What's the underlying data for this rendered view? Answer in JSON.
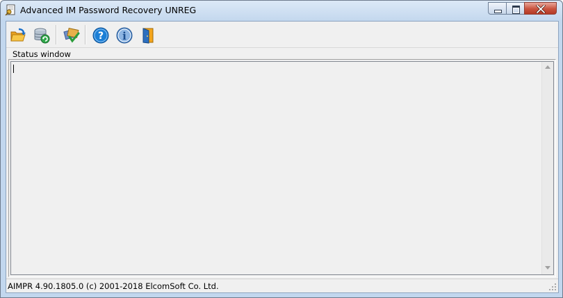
{
  "window": {
    "title": "Advanced IM Password Recovery UNREG"
  },
  "icons": {
    "app": "key-document-icon",
    "open": "open-folder-icon",
    "database": "database-refresh-icon",
    "passwords": "passwords-check-icon",
    "help": "help-question-icon",
    "info": "info-icon",
    "exit": "exit-door-icon"
  },
  "status_window": {
    "label": "Status window",
    "content": ""
  },
  "statusbar": {
    "text": "AIMPR 4.90.1805.0 (c) 2001-2018 ElcomSoft Co. Ltd."
  },
  "colors": {
    "titlebar": "#c4d8ee",
    "close_button": "#c9533e",
    "client_background": "#f0f0f0",
    "help_blue": "#1c7fd6"
  }
}
